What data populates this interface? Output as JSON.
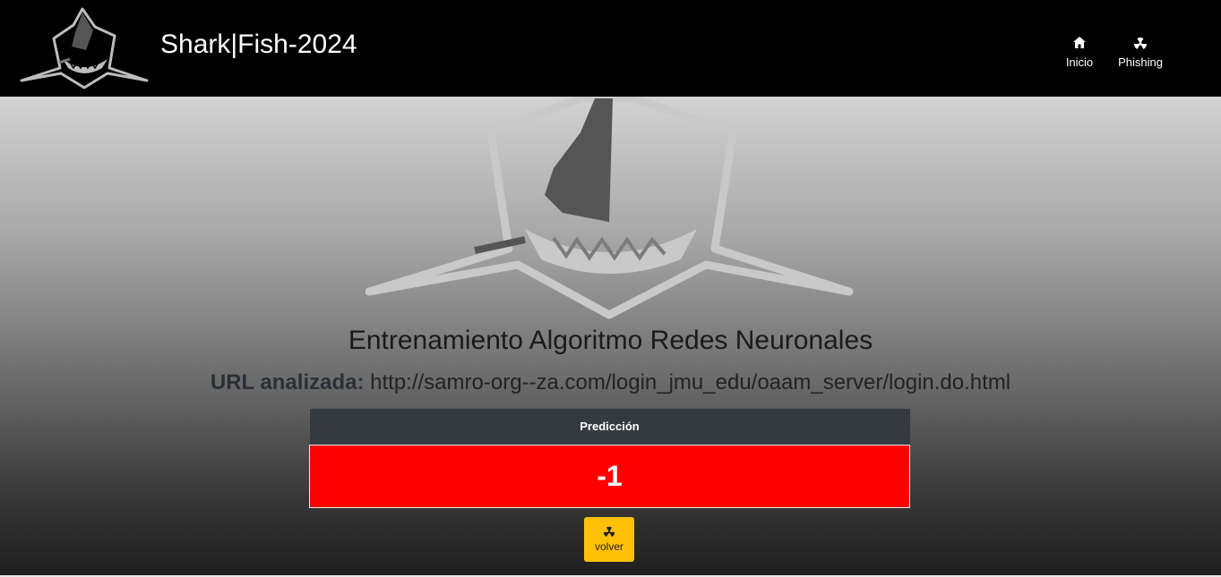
{
  "header": {
    "title": "Shark|Fish-2024",
    "logo_icon": "shark-logo-icon",
    "nav": [
      {
        "label": "Inicio",
        "icon": "home-icon"
      },
      {
        "label": "Phishing",
        "icon": "radiation-icon"
      }
    ]
  },
  "main": {
    "heading": "Entrenamiento Algoritmo Redes Neuronales",
    "url_label": "URL analizada:",
    "url_value": "http://samro-org--za.com/login_jmu_edu/oaam_server/login.do.html",
    "table": {
      "header": "Predicción",
      "value": "-1"
    },
    "back_button": {
      "label": "volver",
      "icon": "radiation-icon"
    }
  },
  "colors": {
    "header_bg": "#000000",
    "table_header_bg": "#343a40",
    "prediction_bg": "#ff0000",
    "button_bg": "#ffc107"
  }
}
